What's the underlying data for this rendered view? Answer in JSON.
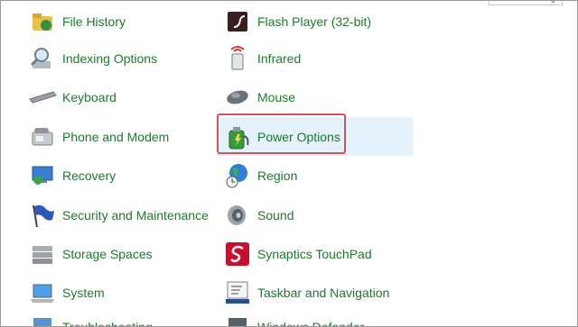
{
  "items": {
    "file_history": "File History",
    "flash_player": "Flash Player (32-bit)",
    "indexing_options": "Indexing Options",
    "infrared": "Infrared",
    "keyboard": "Keyboard",
    "mouse": "Mouse",
    "phone_and_modem": "Phone and Modem",
    "power_options": "Power Options",
    "recovery": "Recovery",
    "region": "Region",
    "security_and_maintenance": "Security and Maintenance",
    "sound": "Sound",
    "storage_spaces": "Storage Spaces",
    "synaptics_touchpad": "Synaptics TouchPad",
    "system": "System",
    "taskbar_and_navigation": "Taskbar and Navigation",
    "troubleshooting": "Troubleshooting",
    "windows_defender": "Windows Defender"
  },
  "icons": {
    "file_history": "file-history-icon",
    "flash_player": "flash-player-icon",
    "indexing_options": "indexing-options-icon",
    "infrared": "infrared-icon",
    "keyboard": "keyboard-icon",
    "mouse": "mouse-icon",
    "phone_and_modem": "phone-modem-icon",
    "power_options": "power-options-icon",
    "recovery": "recovery-icon",
    "region": "region-globe-icon",
    "security_and_maintenance": "security-flag-icon",
    "sound": "speaker-icon",
    "storage_spaces": "storage-spaces-icon",
    "synaptics_touchpad": "synaptics-icon",
    "system": "system-laptop-icon",
    "taskbar_and_navigation": "taskbar-icon"
  },
  "colors": {
    "link_text": "#1e7a2e",
    "highlight_border": "#d2545c",
    "hover_background": "#e5f1fb"
  }
}
